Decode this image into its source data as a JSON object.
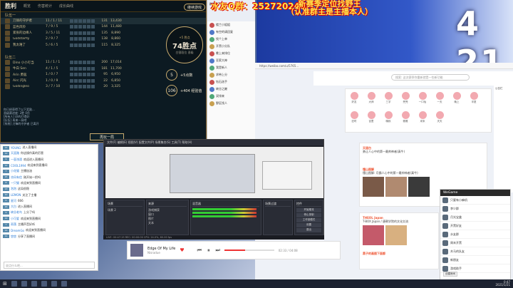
{
  "lol": {
    "title": "胜利",
    "tabs": [
      "概览",
      "伤害统计",
      "成长曲线"
    ],
    "continue_label": "继续游戏",
    "play_again_label": "再玩一局",
    "team1_header": "队伍一",
    "team2_header": "队伍二",
    "team1": [
      {
        "name": "刀锋的守护者",
        "kda": "11 / 1 / 11",
        "cs": "131",
        "gold": "13,430"
      },
      {
        "name": "蓝色风铃",
        "kda": "7 / 9 / 5",
        "cs": "144",
        "gold": "11,480"
      },
      {
        "name": "紧张的边缘人",
        "kda": "3 / 5 / 11",
        "cs": "135",
        "gold": "8,890"
      },
      {
        "name": "Godstarfly",
        "kda": "2 / 9 / 7",
        "cs": "138",
        "gold": "8,860"
      },
      {
        "name": "我太难了",
        "kda": "5 / 6 / 5",
        "cs": "115",
        "gold": "8,325"
      }
    ],
    "team2": [
      {
        "name": "Dino 小小叮当",
        "kda": "11 / 1 / 1",
        "cs": "200",
        "gold": "17,014"
      },
      {
        "name": "牛白 Sen",
        "kda": "4 / 1 / 5",
        "cs": "181",
        "gold": "11,700"
      },
      {
        "name": "Arin 勇猛",
        "kda": "1 / 0 / 7",
        "cs": "95",
        "gold": "6,950"
      },
      {
        "name": "Airc 闪光",
        "kda": "1 / 0 / 9",
        "cs": "22",
        "gold": "6,850"
      },
      {
        "name": "Godingleo",
        "kda": "3 / 7 / 10",
        "cs": "20",
        "gold": "3,325"
      }
    ],
    "win_points_tag": "+5 胜点",
    "win_points": "74胜点",
    "win_points_sub": "白银段位 晋级",
    "badge1_value": "5",
    "badge1_text": "+5点数",
    "badge2_value": "106",
    "badge2_text": "+404 经验值",
    "chat_lines": [
      "你已经获得了以下奖励...",
      "晋级赛进度: 2胜 0负",
      "[所有人] 好的打得好",
      "[队伍] 再来一局吧",
      "[系统] 刀锋的守护者 已离开"
    ]
  },
  "banner": {
    "left": "水友Q群：252720240",
    "right_line1": "新赛季定位找野王",
    "right_line2": "（认准群主是主播本人）"
  },
  "qqgroup": {
    "header": "群聊 2741",
    "members": [
      "楼兰小姐姐",
      "有空的请回复",
      "找个上单",
      "开黑小分队",
      "晚上来排位",
      "亚索大神",
      "我是新人",
      "求带上分",
      "钻石选手",
      "峡谷之巅",
      "双排来",
      "野区找人"
    ]
  },
  "browser": {
    "address": "https://weibo.com/u/5765...",
    "search_placeholder": "搜索: 这次赛季你重新就是一些新功能",
    "avatars": [
      "好友",
      "大师",
      "三字",
      "兜兜",
      "一口仙",
      "一天",
      "晚上",
      "半夏",
      "旧时",
      "百里",
      "晚秋",
      "雅雅",
      "米米",
      "天天"
    ],
    "post1_user": "天道白",
    "post1_text": "勇让人心中的第一最帅神者(真牛)",
    "post2_user": "懂山图解",
    "post2_text": "懂山图解: 月霸人心中的第一最帅神者(真牛)",
    "post3_user": "THEOL Japan",
    "post3_text": "T-BOX Japan / 唐朝学院的文化交流",
    "post4_user": "黑子的画图下面都",
    "big_number": "4 21",
    "sidebar_label": "公告栏"
  },
  "obs": {
    "menu": "文件(F) 编辑(E) 视图(V) 配置文件(P) 场景集合(S) 工具(T) 帮助(H)",
    "docks": [
      "场景",
      "来源",
      "混音器",
      "场景过渡",
      "控件"
    ],
    "scene": "场景 2",
    "sources": [
      "游戏捕获",
      "窗口",
      "图片",
      "文本"
    ],
    "controls": [
      "开始推流",
      "停止录制",
      "工作室模式",
      "设置",
      "退出"
    ],
    "status": "LIVE: 00:47:19  REC: 00:00:00  CPU: 24.0%, 60.00 fps"
  },
  "music": {
    "song": "Edge Of My Life",
    "artist": "Nisradue",
    "progress": 0.42,
    "time": "02:33 / 04:08"
  },
  "chat": {
    "lines": [
      {
        "lv": "14",
        "user": "YOUNG",
        "msg": "进入直播间"
      },
      {
        "lv": "12",
        "user": "天涯路",
        "msg": "你这操作真的厉害"
      },
      {
        "lv": "9",
        "user": "一壶浊酒",
        "msg": "欢迎进入直播间"
      },
      {
        "lv": "11",
        "user": "COOL1994",
        "msg": "欢迎来到直播间"
      },
      {
        "lv": "7",
        "user": "小花猫",
        "msg": "主播加油"
      },
      {
        "lv": "15",
        "user": "凉风有信",
        "msg": "刚开始一把吗"
      },
      {
        "lv": "8",
        "user": "一只猫",
        "msg": "欢迎来到直播间"
      },
      {
        "lv": "13",
        "user": "泡泡",
        "msg": "这局很稳"
      },
      {
        "lv": "10",
        "user": "LEMON",
        "msg": "关注了主播"
      },
      {
        "lv": "6",
        "user": "星河",
        "msg": "666"
      },
      {
        "lv": "16",
        "user": "大白",
        "msg": "进入直播间"
      },
      {
        "lv": "9",
        "user": "峡谷老鸟",
        "msg": "上分了吗"
      },
      {
        "lv": "12",
        "user": "小可爱",
        "msg": "欢迎来到直播间"
      },
      {
        "lv": "7",
        "user": "雨落",
        "msg": "主播声音好听"
      },
      {
        "lv": "14",
        "user": "DreamGo",
        "msg": "欢迎来到直播间"
      },
      {
        "lv": "11",
        "user": "悠悠",
        "msg": "分享了直播间"
      }
    ],
    "input_placeholder": "说点什么吧..."
  },
  "wechat": {
    "title": "WeGame",
    "contacts": [
      "只要有小麻机",
      "李少群",
      "月光宝盒",
      "开黑好友",
      "水友群",
      "周末开黑",
      "木马的队友",
      "新朋友",
      "游戏助手"
    ],
    "button_label": "创建房间"
  },
  "taskbar": {
    "time": "0:47",
    "date": "2021/1/21"
  }
}
